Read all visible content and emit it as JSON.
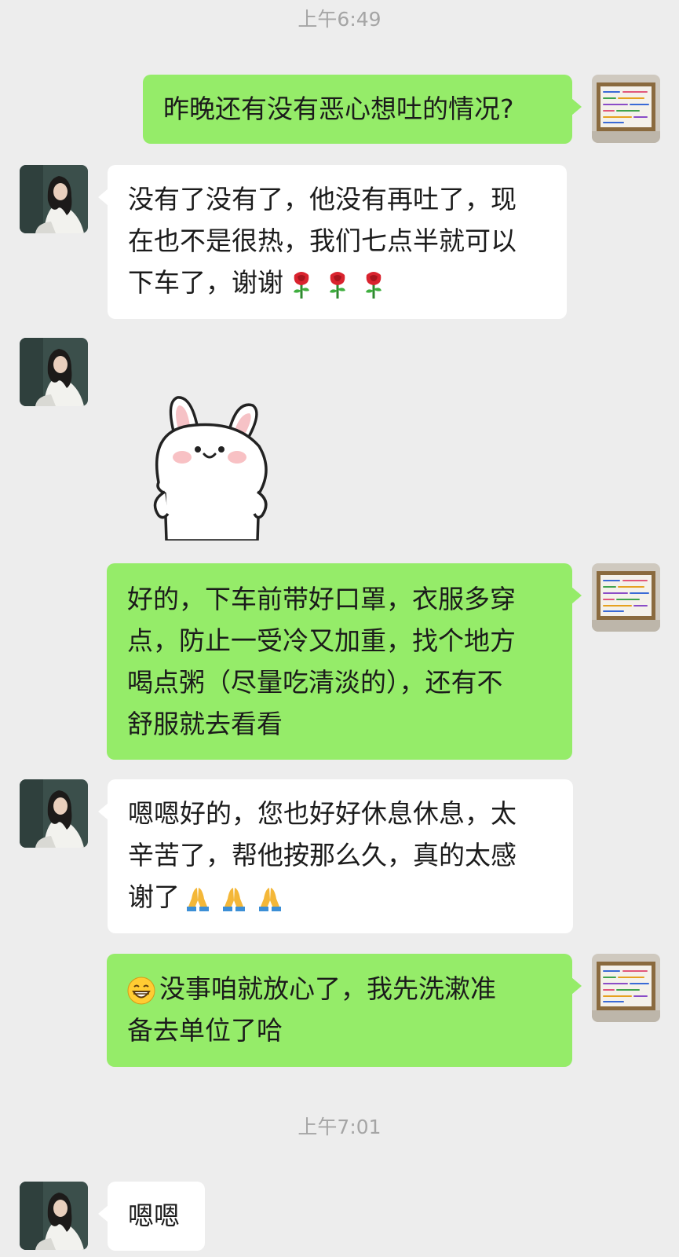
{
  "timestamps": {
    "t1": "上午6:49",
    "t2": "上午7:01"
  },
  "messages": {
    "m1": {
      "side": "out",
      "text": "昨晚还有没有恶心想吐的情况?"
    },
    "m2": {
      "side": "in",
      "lines": [
        "没有了没有了，他没有再吐了，现",
        "在也不是很热，我们七点半就可以",
        "下车了，谢谢"
      ],
      "emoji": "rose-emoji",
      "emoji_count": 3
    },
    "m3": {
      "side": "in",
      "sticker": "bunny-sticker"
    },
    "m4": {
      "side": "out",
      "lines": [
        "好的，下车前带好口罩，衣服多穿",
        "点，防止一受冷又加重，找个地方",
        "喝点粥（尽量吃清淡的），还有不",
        "舒服就去看看"
      ]
    },
    "m5": {
      "side": "in",
      "lines": [
        "嗯嗯好的，您也好好休息休息，太",
        "辛苦了，帮他按那么久，真的太感",
        "谢了"
      ],
      "emoji": "folded-hands-emoji",
      "emoji_count": 3
    },
    "m6": {
      "side": "out",
      "lead_emoji": "grinning-face-emoji",
      "lines": [
        "没事咱就放心了，我先洗漱准",
        "备去单位了哈"
      ]
    },
    "m7": {
      "side": "in",
      "text": "嗯嗯"
    }
  },
  "colors": {
    "background": "#ededed",
    "outgoing_bubble": "#95ec69",
    "incoming_bubble": "#ffffff",
    "timestamp_text": "#a5a5a5"
  }
}
